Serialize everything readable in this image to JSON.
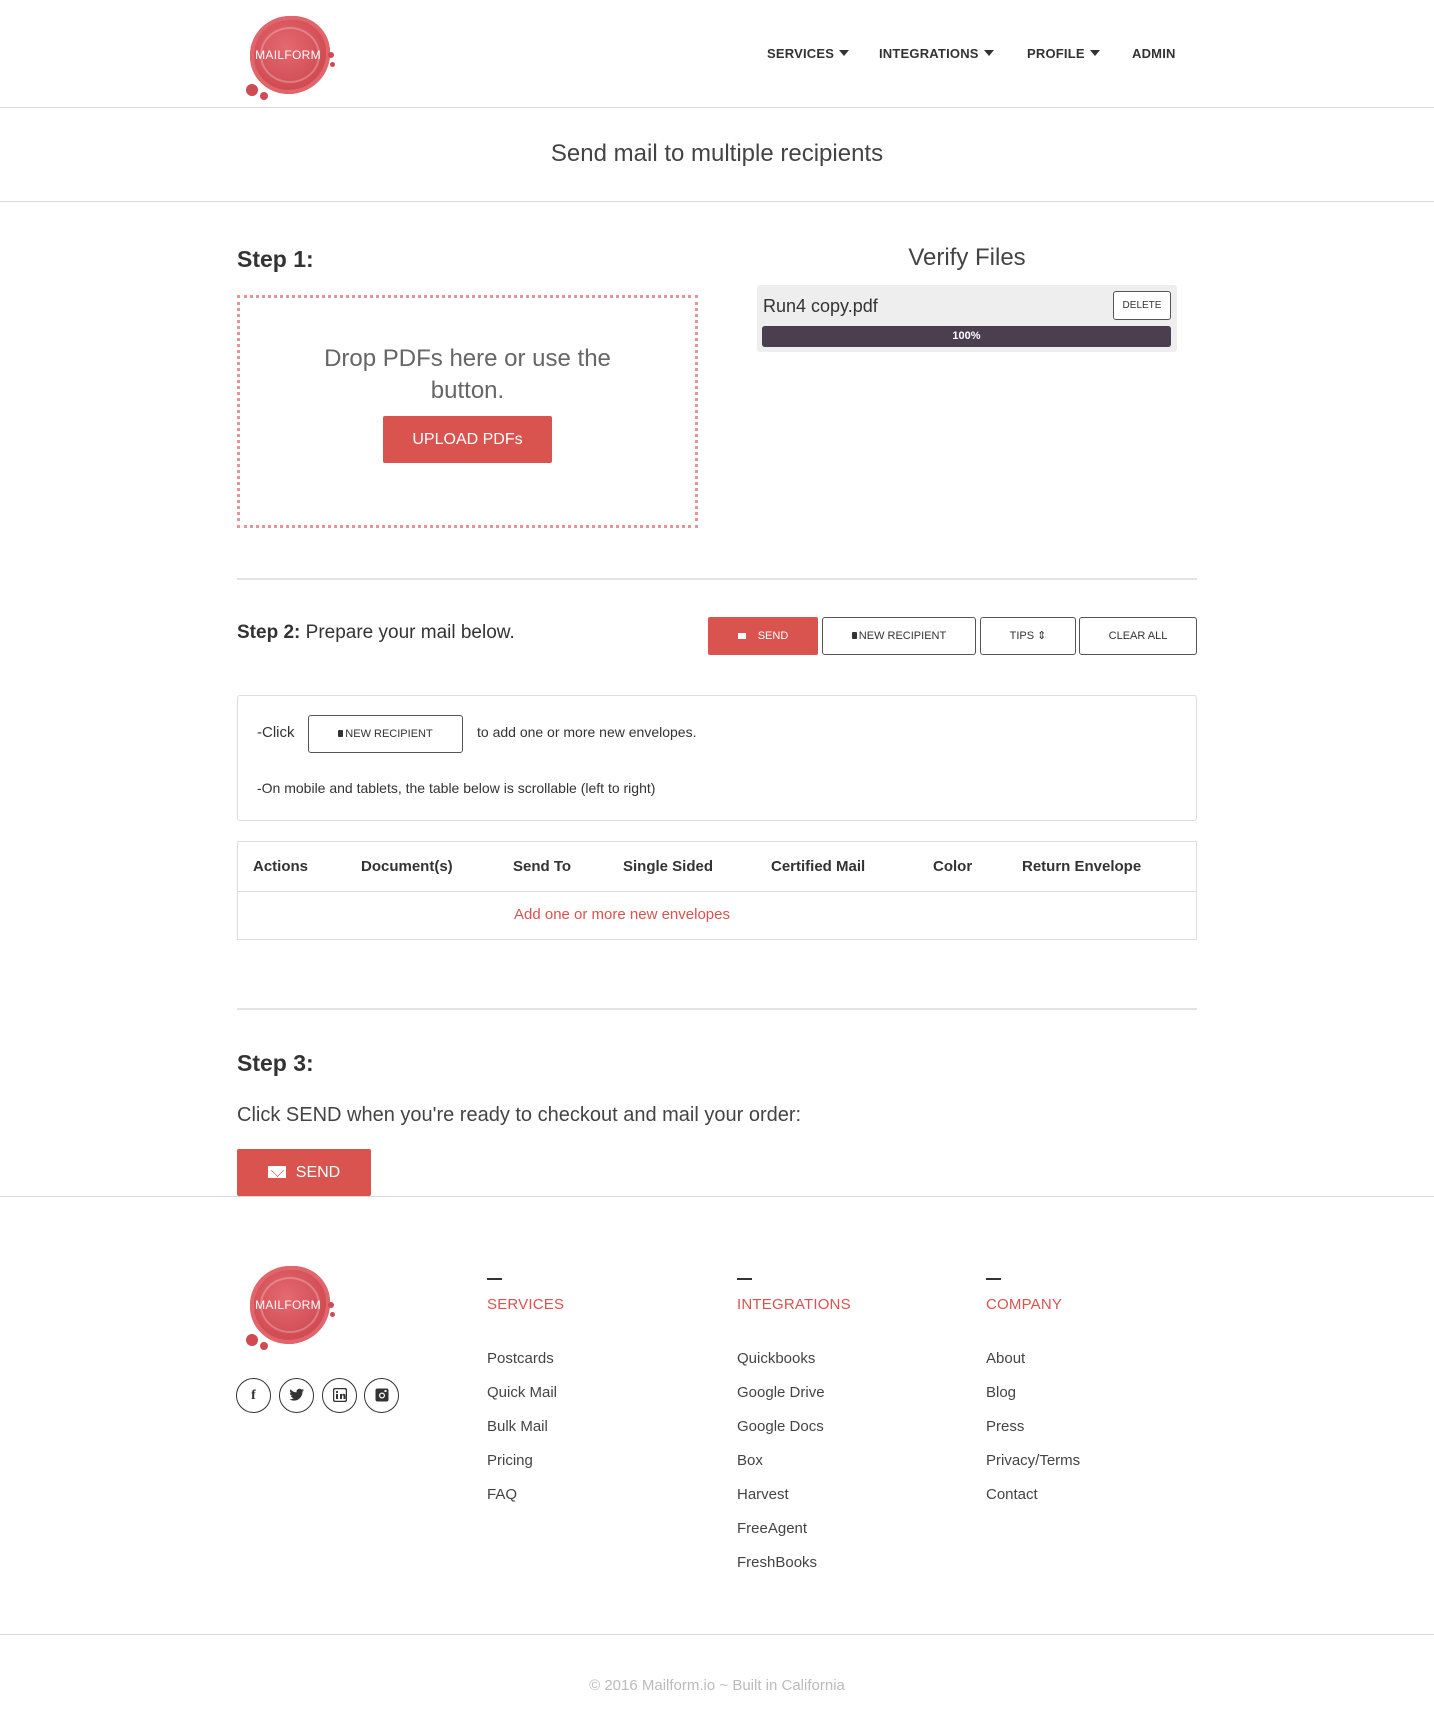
{
  "brand": {
    "logo_text": "MAILFORM",
    "accent": "#d9534f"
  },
  "nav": {
    "services": "SERVICES",
    "integrations": "INTEGRATIONS",
    "profile": "PROFILE",
    "admin": "ADMIN"
  },
  "page_title": "Send mail to multiple recipients",
  "step1": {
    "heading": "Step 1:",
    "drop_text": "Drop PDFs here or use the button.",
    "upload_button": "UPLOAD PDFs"
  },
  "verify": {
    "title": "Verify Files",
    "file_name": "Run4 copy.pdf",
    "delete_label": "DELETE",
    "progress_percent": 100,
    "progress_label": "100%"
  },
  "step2": {
    "heading": "Step 2:",
    "description": "Prepare your mail below.",
    "buttons": {
      "send": "SEND",
      "new_recipient": "NEW RECIPIENT",
      "tips": "TIPS",
      "clear_all": "CLEAR ALL"
    },
    "tips": {
      "click_prefix": "-Click",
      "inline_button": "NEW RECIPIENT",
      "click_suffix": "to add one or more new envelopes.",
      "mobile_note": "-On mobile and tablets, the table below is scrollable (left to right)"
    },
    "table": {
      "columns": [
        "Actions",
        "Document(s)",
        "Send To",
        "Single Sided",
        "Certified Mail",
        "Color",
        "Return Envelope"
      ],
      "empty_message": "Add one or more new envelopes"
    }
  },
  "step3": {
    "heading": "Step 3:",
    "text": "Click SEND when you're ready to checkout and mail your order:",
    "send_button": "SEND"
  },
  "footer": {
    "logo_text": "MAILFORM",
    "social": [
      "facebook-icon",
      "twitter-icon",
      "linkedin-icon",
      "instagram-icon"
    ],
    "columns": [
      {
        "title": "SERVICES",
        "links": [
          "Postcards",
          "Quick Mail",
          "Bulk Mail",
          "Pricing",
          "FAQ"
        ]
      },
      {
        "title": "INTEGRATIONS",
        "links": [
          "Quickbooks",
          "Google Drive",
          "Google Docs",
          "Box",
          "Harvest",
          "FreeAgent",
          "FreshBooks"
        ]
      },
      {
        "title": "COMPANY",
        "links": [
          "About",
          "Blog",
          "Press",
          "Privacy/Terms",
          "Contact"
        ]
      }
    ],
    "copyright": "© 2016 Mailform.io ~ Built in California"
  }
}
